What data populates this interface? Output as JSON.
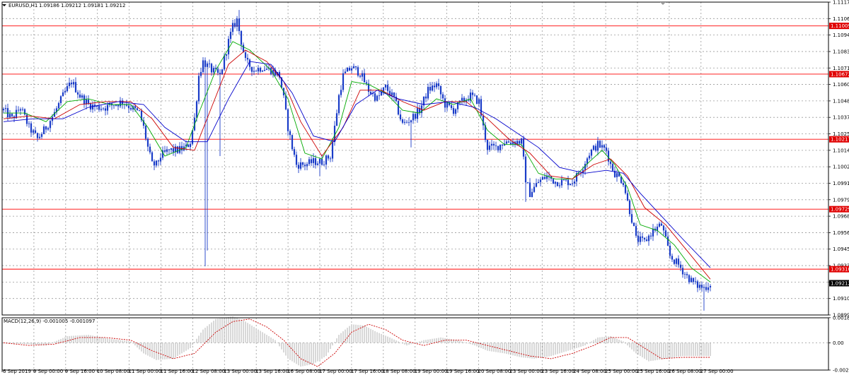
{
  "chart_data": {
    "type": "candlestick",
    "header": {
      "symbol": "EURUSD,H1",
      "ohlc": "1.09186 1.09212 1.09181 1.09212"
    },
    "price_axis": {
      "ylim": [
        1.0899,
        1.11175
      ],
      "ticks": [
        "1.11175",
        "1.11060",
        "1.10945",
        "1.10830",
        "1.10715",
        "1.10600",
        "1.10485",
        "1.10370",
        "1.10255",
        "1.10140",
        "1.10025",
        "1.09910",
        "1.09795",
        "1.09680",
        "1.09565",
        "1.09450",
        "1.09335",
        "1.09220",
        "1.09105",
        "1.08990"
      ]
    },
    "horizontal_levels": [
      {
        "value": 1.11009,
        "label": "1.11009"
      },
      {
        "value": 1.10672,
        "label": "1.10672"
      },
      {
        "value": 1.10217,
        "label": "1.10217"
      },
      {
        "value": 1.09729,
        "label": "1.09729"
      },
      {
        "value": 1.0931,
        "label": "1.09310"
      }
    ],
    "current_price": {
      "value": 1.09212,
      "label": "1.09212"
    },
    "time_axis": {
      "labels": [
        "6 Sep 2019",
        "9 Sep 00:00",
        "9 Sep 16:00",
        "10 Sep 08:00",
        "11 Sep 00:00",
        "11 Sep 16:00",
        "12 Sep 08:00",
        "13 Sep 00:00",
        "13 Sep 16:00",
        "16 Sep 08:00",
        "17 Sep 00:00",
        "17 Sep 16:00",
        "18 Sep 08:00",
        "19 Sep 00:00",
        "19 Sep 16:00",
        "20 Sep 08:00",
        "23 Sep 00:00",
        "23 Sep 16:00",
        "24 Sep 08:00",
        "25 Sep 00:00",
        "25 Sep 16:00",
        "26 Sep 08:00",
        "27 Sep 00:00"
      ]
    },
    "price_path": [
      [
        0,
        1.1042
      ],
      [
        4,
        1.1036
      ],
      [
        8,
        1.1044
      ],
      [
        12,
        1.103
      ],
      [
        16,
        1.1022
      ],
      [
        20,
        1.103
      ],
      [
        24,
        1.104
      ],
      [
        28,
        1.1052
      ],
      [
        32,
        1.1062
      ],
      [
        36,
        1.1052
      ],
      [
        40,
        1.1046
      ],
      [
        44,
        1.1044
      ],
      [
        48,
        1.1044
      ],
      [
        52,
        1.1046
      ],
      [
        56,
        1.1048
      ],
      [
        60,
        1.1044
      ],
      [
        64,
        1.104
      ],
      [
        66,
        1.103
      ],
      [
        68,
        1.1016
      ],
      [
        70,
        1.1004
      ],
      [
        72,
        1.1004
      ],
      [
        74,
        1.101
      ],
      [
        78,
        1.1014
      ],
      [
        82,
        1.1014
      ],
      [
        86,
        1.1016
      ],
      [
        88,
        1.102
      ],
      [
        90,
        1.1036
      ],
      [
        92,
        1.1066
      ],
      [
        94,
        1.1076
      ],
      [
        98,
        1.107
      ],
      [
        102,
        1.1066
      ],
      [
        106,
        1.109
      ],
      [
        108,
        1.11
      ],
      [
        110,
        1.1105
      ],
      [
        112,
        1.109
      ],
      [
        114,
        1.1076
      ],
      [
        118,
        1.107
      ],
      [
        122,
        1.1072
      ],
      [
        126,
        1.107
      ],
      [
        130,
        1.1066
      ],
      [
        132,
        1.105
      ],
      [
        134,
        1.103
      ],
      [
        136,
        1.1016
      ],
      [
        138,
        1.1004
      ],
      [
        142,
        1.1004
      ],
      [
        146,
        1.1006
      ],
      [
        150,
        1.1006
      ],
      [
        154,
        1.101
      ],
      [
        156,
        1.103
      ],
      [
        158,
        1.1052
      ],
      [
        160,
        1.1066
      ],
      [
        164,
        1.1072
      ],
      [
        168,
        1.1068
      ],
      [
        172,
        1.1056
      ],
      [
        176,
        1.105
      ],
      [
        180,
        1.1058
      ],
      [
        184,
        1.105
      ],
      [
        188,
        1.1032
      ],
      [
        192,
        1.1036
      ],
      [
        196,
        1.1042
      ],
      [
        200,
        1.1056
      ],
      [
        204,
        1.106
      ],
      [
        208,
        1.1046
      ],
      [
        212,
        1.1042
      ],
      [
        216,
        1.1048
      ],
      [
        220,
        1.1052
      ],
      [
        224,
        1.1048
      ],
      [
        226,
        1.103
      ],
      [
        228,
        1.1016
      ],
      [
        232,
        1.1016
      ],
      [
        236,
        1.102
      ],
      [
        240,
        1.102
      ],
      [
        244,
        1.102
      ],
      [
        246,
        1.0994
      ],
      [
        248,
        1.0984
      ],
      [
        252,
        1.0992
      ],
      [
        256,
        1.0996
      ],
      [
        260,
        1.0992
      ],
      [
        264,
        1.0992
      ],
      [
        268,
        1.0992
      ],
      [
        272,
        1.1
      ],
      [
        276,
        1.1012
      ],
      [
        280,
        1.1018
      ],
      [
        284,
        1.1014
      ],
      [
        286,
        1.1004
      ],
      [
        288,
        1.0998
      ],
      [
        292,
        1.0992
      ],
      [
        294,
        1.0978
      ],
      [
        296,
        1.0966
      ],
      [
        298,
        1.0952
      ],
      [
        302,
        1.095
      ],
      [
        306,
        1.0958
      ],
      [
        310,
        1.0962
      ],
      [
        314,
        1.094
      ],
      [
        318,
        1.0934
      ],
      [
        322,
        1.0926
      ],
      [
        326,
        1.092
      ],
      [
        330,
        1.0918
      ],
      [
        333,
        1.0921
      ]
    ],
    "ma_lines": [
      {
        "color": "#00aa00",
        "points": [
          [
            0,
            1.104
          ],
          [
            10,
            1.104
          ],
          [
            20,
            1.1034
          ],
          [
            30,
            1.1048
          ],
          [
            40,
            1.105
          ],
          [
            50,
            1.1046
          ],
          [
            60,
            1.1046
          ],
          [
            68,
            1.103
          ],
          [
            76,
            1.101
          ],
          [
            86,
            1.1016
          ],
          [
            92,
            1.104
          ],
          [
            100,
            1.107
          ],
          [
            108,
            1.109
          ],
          [
            116,
            1.1084
          ],
          [
            126,
            1.107
          ],
          [
            134,
            1.105
          ],
          [
            142,
            1.1012
          ],
          [
            150,
            1.1008
          ],
          [
            158,
            1.103
          ],
          [
            164,
            1.1062
          ],
          [
            172,
            1.106
          ],
          [
            180,
            1.1054
          ],
          [
            188,
            1.1042
          ],
          [
            196,
            1.104
          ],
          [
            204,
            1.105
          ],
          [
            212,
            1.1046
          ],
          [
            220,
            1.105
          ],
          [
            228,
            1.1028
          ],
          [
            236,
            1.1018
          ],
          [
            244,
            1.1018
          ],
          [
            252,
            1.0998
          ],
          [
            260,
            1.0994
          ],
          [
            268,
            1.0994
          ],
          [
            276,
            1.1006
          ],
          [
            282,
            1.1014
          ],
          [
            288,
            1.1004
          ],
          [
            294,
            1.0988
          ],
          [
            300,
            1.0962
          ],
          [
            308,
            1.0958
          ],
          [
            316,
            1.0948
          ],
          [
            324,
            1.0932
          ],
          [
            333,
            1.0922
          ]
        ]
      },
      {
        "color": "#cc0000",
        "points": [
          [
            0,
            1.1036
          ],
          [
            12,
            1.1038
          ],
          [
            24,
            1.1036
          ],
          [
            36,
            1.1046
          ],
          [
            48,
            1.1048
          ],
          [
            60,
            1.1048
          ],
          [
            70,
            1.1036
          ],
          [
            80,
            1.1016
          ],
          [
            90,
            1.1014
          ],
          [
            98,
            1.1044
          ],
          [
            106,
            1.1074
          ],
          [
            114,
            1.1084
          ],
          [
            124,
            1.1076
          ],
          [
            132,
            1.1062
          ],
          [
            140,
            1.1034
          ],
          [
            150,
            1.101
          ],
          [
            160,
            1.103
          ],
          [
            168,
            1.1056
          ],
          [
            178,
            1.1056
          ],
          [
            188,
            1.1048
          ],
          [
            198,
            1.1042
          ],
          [
            208,
            1.1048
          ],
          [
            218,
            1.1048
          ],
          [
            228,
            1.1036
          ],
          [
            238,
            1.1022
          ],
          [
            248,
            1.1012
          ],
          [
            258,
            1.0996
          ],
          [
            268,
            1.0994
          ],
          [
            278,
            1.1004
          ],
          [
            286,
            1.1008
          ],
          [
            294,
            1.0996
          ],
          [
            302,
            1.0974
          ],
          [
            312,
            1.0962
          ],
          [
            322,
            1.0944
          ],
          [
            333,
            1.0924
          ]
        ]
      },
      {
        "color": "#0000cc",
        "points": [
          [
            0,
            1.1034
          ],
          [
            14,
            1.1036
          ],
          [
            28,
            1.1036
          ],
          [
            40,
            1.1044
          ],
          [
            54,
            1.1048
          ],
          [
            66,
            1.1046
          ],
          [
            76,
            1.103
          ],
          [
            86,
            1.102
          ],
          [
            96,
            1.102
          ],
          [
            106,
            1.105
          ],
          [
            116,
            1.1076
          ],
          [
            126,
            1.1074
          ],
          [
            136,
            1.1054
          ],
          [
            146,
            1.1024
          ],
          [
            156,
            1.102
          ],
          [
            166,
            1.1046
          ],
          [
            176,
            1.1056
          ],
          [
            186,
            1.105
          ],
          [
            198,
            1.1046
          ],
          [
            210,
            1.1048
          ],
          [
            222,
            1.1044
          ],
          [
            232,
            1.1036
          ],
          [
            242,
            1.1026
          ],
          [
            252,
            1.1016
          ],
          [
            262,
            1.1002
          ],
          [
            274,
            1.0998
          ],
          [
            284,
            1.1
          ],
          [
            292,
            1.0998
          ],
          [
            300,
            1.0984
          ],
          [
            310,
            1.0968
          ],
          [
            320,
            1.0952
          ],
          [
            333,
            1.0932
          ]
        ]
      }
    ],
    "macd": {
      "label": "MACD(12,26,9) -0.001005 -0.001097",
      "ylim": [
        -0.00206,
        0.00189
      ],
      "ticks": [
        "0.001899",
        "0.00",
        "-0.00206"
      ],
      "histogram": [
        [
          0,
          0.0
        ],
        [
          10,
          -0.0001
        ],
        [
          20,
          -0.0002
        ],
        [
          30,
          0.0005
        ],
        [
          40,
          0.0006
        ],
        [
          50,
          0.0003
        ],
        [
          60,
          0.0001
        ],
        [
          66,
          -0.0008
        ],
        [
          72,
          -0.0013
        ],
        [
          80,
          -0.0012
        ],
        [
          88,
          -0.0004
        ],
        [
          94,
          0.001
        ],
        [
          100,
          0.0018
        ],
        [
          108,
          0.002
        ],
        [
          114,
          0.0016
        ],
        [
          122,
          0.0008
        ],
        [
          128,
          0.0002
        ],
        [
          134,
          -0.0012
        ],
        [
          140,
          -0.0018
        ],
        [
          146,
          -0.0016
        ],
        [
          152,
          -0.001
        ],
        [
          158,
          0.0006
        ],
        [
          164,
          0.0014
        ],
        [
          170,
          0.0013
        ],
        [
          176,
          0.0008
        ],
        [
          182,
          0.0004
        ],
        [
          190,
          -0.0002
        ],
        [
          198,
          0.0002
        ],
        [
          206,
          0.0004
        ],
        [
          214,
          0.0002
        ],
        [
          222,
          -0.0002
        ],
        [
          228,
          -0.0006
        ],
        [
          236,
          -0.0008
        ],
        [
          244,
          -0.0011
        ],
        [
          250,
          -0.0012
        ],
        [
          258,
          -0.001
        ],
        [
          266,
          -0.0006
        ],
        [
          274,
          -0.0002
        ],
        [
          280,
          0.0004
        ],
        [
          286,
          0.0005
        ],
        [
          292,
          0.0001
        ],
        [
          298,
          -0.0008
        ],
        [
          304,
          -0.0014
        ],
        [
          312,
          -0.0012
        ],
        [
          320,
          -0.001
        ],
        [
          333,
          -0.001
        ]
      ],
      "signal": [
        [
          0,
          0.0
        ],
        [
          12,
          -0.0002
        ],
        [
          24,
          -0.0001
        ],
        [
          36,
          0.0004
        ],
        [
          48,
          0.0004
        ],
        [
          60,
          0.0002
        ],
        [
          70,
          -0.0006
        ],
        [
          80,
          -0.0012
        ],
        [
          90,
          -0.0008
        ],
        [
          100,
          0.0008
        ],
        [
          108,
          0.0016
        ],
        [
          116,
          0.0018
        ],
        [
          124,
          0.0012
        ],
        [
          132,
          0.0002
        ],
        [
          140,
          -0.0012
        ],
        [
          148,
          -0.0018
        ],
        [
          156,
          -0.0008
        ],
        [
          164,
          0.0008
        ],
        [
          172,
          0.0014
        ],
        [
          180,
          0.001
        ],
        [
          188,
          0.0002
        ],
        [
          198,
          -0.0002
        ],
        [
          208,
          0.0002
        ],
        [
          218,
          0.0002
        ],
        [
          228,
          -0.0002
        ],
        [
          238,
          -0.0006
        ],
        [
          248,
          -0.001
        ],
        [
          258,
          -0.0012
        ],
        [
          268,
          -0.0008
        ],
        [
          278,
          -0.0002
        ],
        [
          286,
          0.0004
        ],
        [
          294,
          0.0004
        ],
        [
          302,
          -0.0004
        ],
        [
          310,
          -0.0012
        ],
        [
          320,
          -0.0011
        ],
        [
          333,
          -0.0011
        ]
      ]
    }
  }
}
